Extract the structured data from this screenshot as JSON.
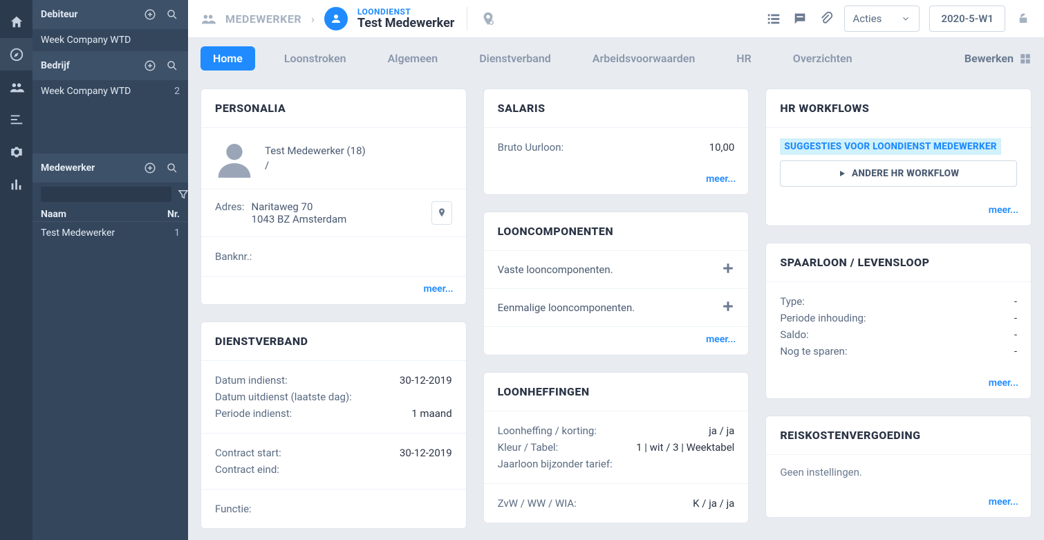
{
  "rail": {
    "items": [
      "home",
      "compass",
      "people",
      "filter",
      "settings",
      "stats"
    ]
  },
  "sidebar": {
    "debiteur": {
      "title": "Debiteur",
      "items": [
        {
          "name": "Week Company WTD"
        }
      ]
    },
    "bedrijf": {
      "title": "Bedrijf",
      "items": [
        {
          "name": "Week Company WTD",
          "count": "2"
        }
      ]
    },
    "medewerker": {
      "title": "Medewerker",
      "table_header": {
        "name": "Naam",
        "nr": "Nr."
      },
      "items": [
        {
          "name": "Test Medewerker",
          "nr": "1"
        }
      ]
    }
  },
  "header": {
    "breadcrumb": "MEDEWERKER",
    "sub": "LOONDIENST",
    "name": "Test Medewerker",
    "action_dropdown": "Acties",
    "period": "2020-5-W1"
  },
  "tabs": {
    "home": "Home",
    "loonstroken": "Loonstroken",
    "algemeen": "Algemeen",
    "dienstverband": "Dienstverband",
    "arbeidsvoorwaarden": "Arbeidsvoorwaarden",
    "hr": "HR",
    "overzichten": "Overzichten",
    "bewerken": "Bewerken"
  },
  "cards": {
    "personalia": {
      "title": "PERSONALIA",
      "name": "Test Medewerker (18)",
      "slash": "/",
      "addr_label": "Adres:",
      "addr_line1": "Naritaweg 70",
      "addr_line2": "1043 BZ Amsterdam",
      "bank": "Banknr.:",
      "more": "meer..."
    },
    "dienstverband": {
      "title": "DIENSTVERBAND",
      "datum_indienst_label": "Datum indienst:",
      "datum_indienst_value": "30-12-2019",
      "datum_uitdienst_label": "Datum uitdienst (laatste dag):",
      "periode_indienst_label": "Periode indienst:",
      "periode_indienst_value": "1 maand",
      "contract_start_label": "Contract start:",
      "contract_start_value": "30-12-2019",
      "contract_eind_label": "Contract eind:",
      "functie_label": "Functie:"
    },
    "salaris": {
      "title": "SALARIS",
      "bruto_label": "Bruto Uurloon:",
      "bruto_value": "10,00",
      "more": "meer..."
    },
    "looncomponenten": {
      "title": "LOONCOMPONENTEN",
      "vaste": "Vaste looncomponenten.",
      "eenmalige": "Eenmalige looncomponenten.",
      "more": "meer..."
    },
    "loonheffingen": {
      "title": "LOONHEFFINGEN",
      "loonheffing_label": "Loonheffing / korting:",
      "loonheffing_value": "ja / ja",
      "kleur_label": "Kleur / Tabel:",
      "kleur_value": "1 | wit / 3 | Weektabel",
      "jaarloon_label": "Jaarloon bijzonder tarief:",
      "zvw_label": "ZvW / WW / WIA:",
      "zvw_value": "K / ja / ja"
    },
    "hrworkflows": {
      "title": "HR WORKFLOWS",
      "suggestion": "SUGGESTIES VOOR LOONDIENST MEDEWERKER",
      "action": "ANDERE HR WORKFLOW",
      "more": "meer..."
    },
    "spaarloon": {
      "title": "SPAARLOON / LEVENSLOOP",
      "type_label": "Type:",
      "type_value": "-",
      "periode_label": "Periode inhouding:",
      "periode_value": "-",
      "saldo_label": "Saldo:",
      "saldo_value": "-",
      "nog_label": "Nog te sparen:",
      "nog_value": "-",
      "more": "meer..."
    },
    "reiskosten": {
      "title": "REISKOSTENVERGOEDING",
      "text": "Geen instellingen.",
      "more": "meer..."
    }
  }
}
